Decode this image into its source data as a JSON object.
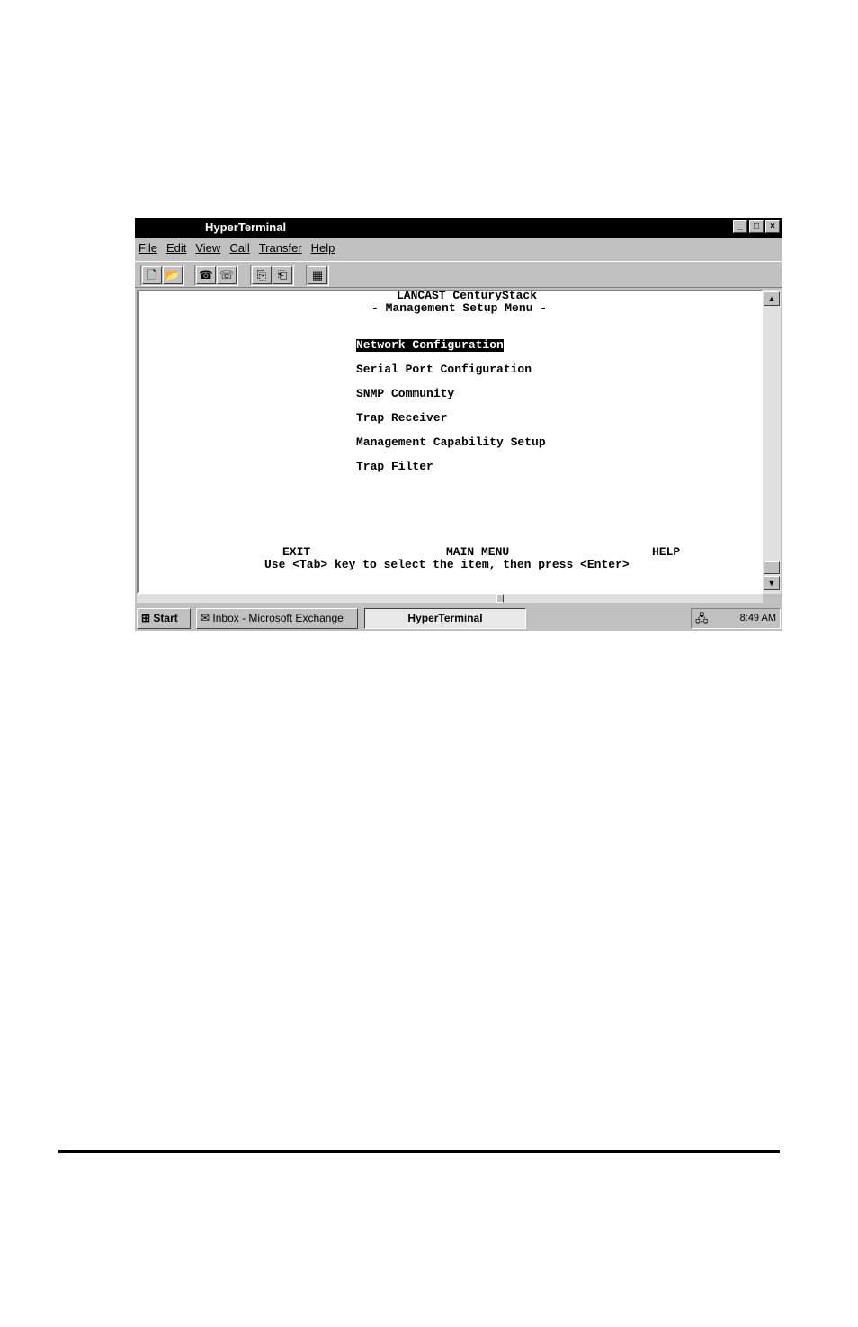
{
  "window": {
    "title": "HyperTerminal",
    "controls": {
      "minimize": "_",
      "maximize": "□",
      "close": "×"
    }
  },
  "menubar": [
    "File",
    "Edit",
    "View",
    "Call",
    "Transfer",
    "Help"
  ],
  "toolbar": {
    "icons": [
      "new-icon",
      "open-icon",
      "connect-icon",
      "disconnect-icon",
      "send-icon",
      "receive-icon",
      "properties-icon"
    ],
    "glyphs": [
      "🗋",
      "📂",
      "☎",
      "☏",
      "⎘",
      "⎗",
      "▦"
    ]
  },
  "terminal": {
    "header_line1": "LANCAST CenturyStack",
    "header_line2": "- Management Setup Menu -",
    "menu_items": [
      "Network Configuration",
      "Serial Port Configuration",
      "SNMP Community",
      "Trap Receiver",
      "Management Capability Setup",
      "Trap Filter"
    ],
    "selected_index": 0,
    "footer_exit": "EXIT",
    "footer_main": "MAIN MENU",
    "footer_help": "HELP",
    "instruction": "Use <Tab> key to select the item, then press <Enter>"
  },
  "taskbar": {
    "start": "Start",
    "inbox": "Inbox - Microsoft Exchange",
    "active_task": "HyperTerminal",
    "clock": "8:49 AM"
  }
}
